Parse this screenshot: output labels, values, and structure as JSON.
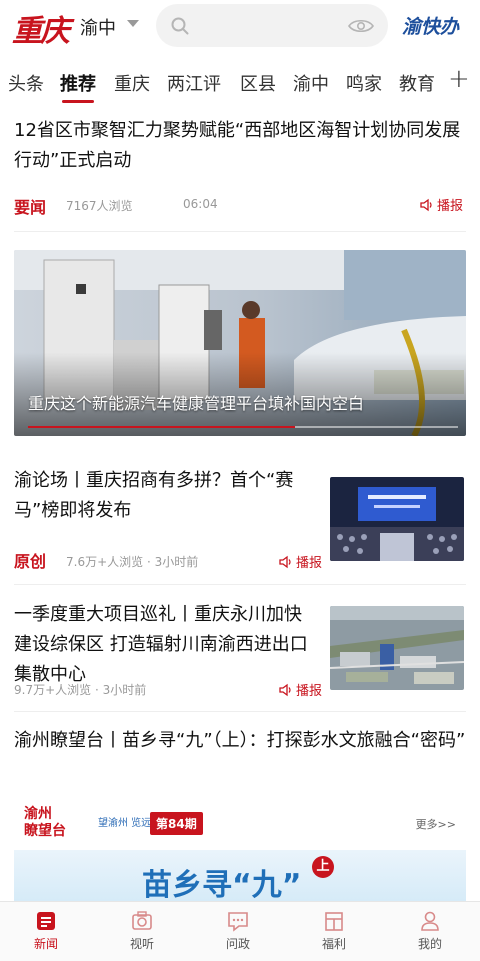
{
  "header": {
    "logo": "重庆",
    "district": "渝中",
    "quick_service": "渝快办"
  },
  "tabs": [
    {
      "label": "头条"
    },
    {
      "label": "推荐"
    },
    {
      "label": "重庆"
    },
    {
      "label": "两江评"
    },
    {
      "label": "区县"
    },
    {
      "label": "渝中"
    },
    {
      "label": "鸣家"
    },
    {
      "label": "教育"
    }
  ],
  "tabs_plus": "+",
  "feed": {
    "a1": {
      "title": "12省区市聚智汇力聚势赋能“西部地区海智计划协同发展行动”正式启动",
      "tag": "要闻",
      "views": "7167人浏览",
      "time": "06:04",
      "play": "播报"
    },
    "banner": {
      "caption": "重庆这个新能源汽车健康管理平台填补国内空白",
      "progress": 0.62
    },
    "a2": {
      "title": "渝论场丨重庆招商有多拼？首个“赛马”榜即将发布",
      "tag": "原创",
      "meta": "7.6万+人浏览 · 3小时前",
      "play": "播报"
    },
    "a3": {
      "title": "一季度重大项目巡礼丨重庆永川加快建设综保区 打造辐射川南渝西进出口集散中心",
      "meta": "9.7万+人浏览 · 3小时前",
      "play": "播报"
    },
    "a4": {
      "title": "渝州瞭望台丨苗乡寻“九”（上）：打探彭水文旅融合“密码”"
    },
    "promo": {
      "logo_text": "渝州\n瞭望台",
      "slogan": "望渝州 览远见",
      "issue": "第84期",
      "more": "更多>>",
      "headline": "苗乡寻“九”",
      "headline_badge": "上"
    }
  },
  "bottom_nav": [
    {
      "label": "新闻",
      "icon": "news-icon",
      "active": true
    },
    {
      "label": "视听",
      "icon": "camera-icon",
      "active": false
    },
    {
      "label": "问政",
      "icon": "message-icon",
      "active": false
    },
    {
      "label": "福利",
      "icon": "gift-icon",
      "active": false
    },
    {
      "label": "我的",
      "icon": "user-icon",
      "active": false
    }
  ],
  "colors": {
    "accent": "#c8141e",
    "brand_blue": "#1d4f9c"
  }
}
